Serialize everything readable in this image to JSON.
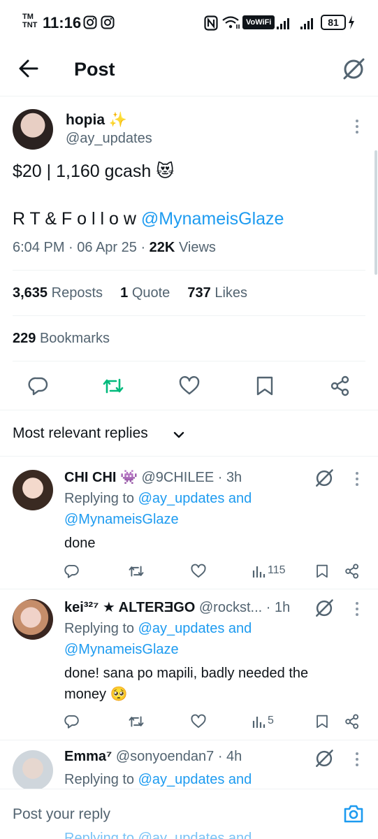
{
  "status_bar": {
    "carrier_top": "TM",
    "carrier_bottom": "TNT",
    "time": "11:16",
    "wifi_label": "VoWiFi",
    "battery": "81"
  },
  "header": {
    "title": "Post"
  },
  "post": {
    "author_name": "hopia",
    "author_emoji": "✨",
    "author_handle": "@ay_updates",
    "text_line1": "$20 | 1,160 gcash",
    "text_emoji": "😻",
    "text_line2_prefix": "R T & F o l l o w",
    "mention": "@MynameisGlaze",
    "time": "6:04 PM",
    "date": "06 Apr 25",
    "views_count": "22K",
    "views_label": "Views"
  },
  "stats": {
    "reposts_count": "3,635",
    "reposts_label": "Reposts",
    "quotes_count": "1",
    "quotes_label": "Quote",
    "likes_count": "737",
    "likes_label": "Likes",
    "bookmarks_count": "229",
    "bookmarks_label": "Bookmarks"
  },
  "replies_filter": {
    "label": "Most relevant replies"
  },
  "replies": [
    {
      "name": "CHI CHI",
      "emoji": "👾",
      "handle": "@9CHILEE",
      "time": "3h",
      "replying_prefix": "Replying to",
      "replying_user1": "@ay_updates",
      "replying_and": "and",
      "replying_user2": "@MynameisGlaze",
      "text_line1": "done",
      "text_line2": "",
      "views": "115"
    },
    {
      "name": "kei³²⁷ ★ ALTERƎGO",
      "emoji": "",
      "handle": "@rockst...",
      "time": "1h",
      "replying_prefix": "Replying to",
      "replying_user1": "@ay_updates",
      "replying_and": "and",
      "replying_user2": "@MynameisGlaze",
      "text_line1": "done! sana po mapili, badly needed the",
      "text_line2": "money",
      "text_emoji": "🥺",
      "views": "5"
    },
    {
      "name": "Emma⁷",
      "emoji": "",
      "handle": "@sonyoendan7",
      "time": "4h",
      "replying_prefix": "Replying to",
      "replying_user1": "@ay_updates",
      "replying_and": "and"
    }
  ],
  "composer": {
    "placeholder": "Post your reply",
    "behind_text": "Replying to @ay_updates and"
  },
  "colors": {
    "accent": "#1d9bf0",
    "repost_active": "#00ba7c",
    "muted": "#536471",
    "divider": "#eff3f4"
  }
}
